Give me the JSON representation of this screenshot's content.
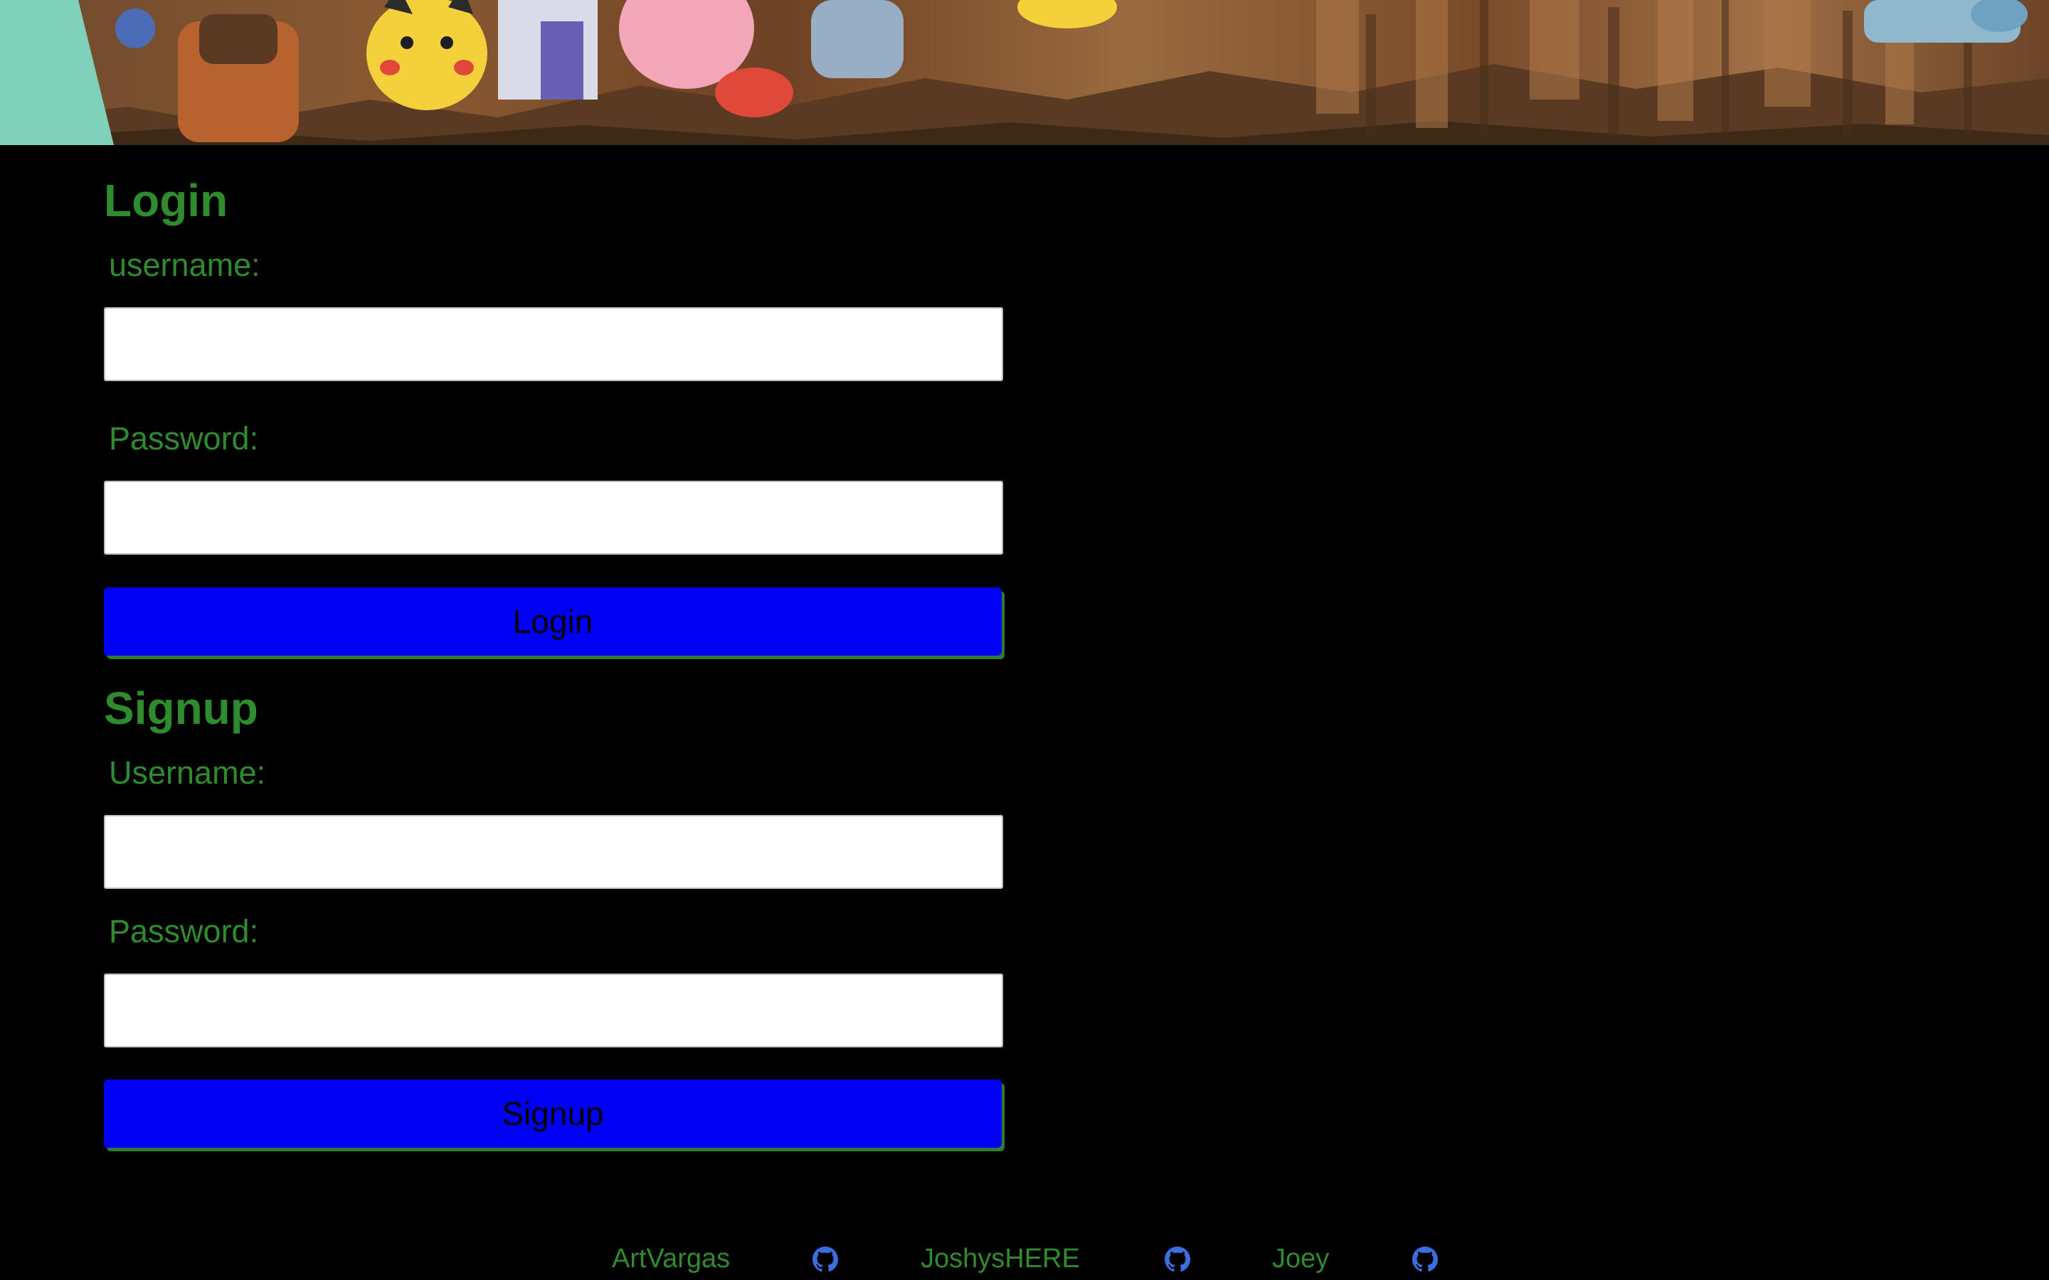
{
  "colors": {
    "accent_green": "#2e8b2e",
    "button_blue": "#0000f5",
    "background": "#000000",
    "github_icon": "#3b6fe0"
  },
  "banner": {
    "description_icon": "banner-image"
  },
  "login": {
    "heading": "Login",
    "username_label": "username:",
    "username_value": "",
    "password_label": "Password:",
    "password_value": "",
    "button_label": "Login"
  },
  "signup": {
    "heading": "Signup",
    "username_label": "Username:",
    "username_value": "",
    "password_label": "Password:",
    "password_value": "",
    "button_label": "Signup"
  },
  "footer": {
    "links": [
      {
        "name": "ArtVargas",
        "icon": "github-icon"
      },
      {
        "name": "JoshysHERE",
        "icon": "github-icon"
      },
      {
        "name": "Joey",
        "icon": "github-icon"
      }
    ]
  }
}
